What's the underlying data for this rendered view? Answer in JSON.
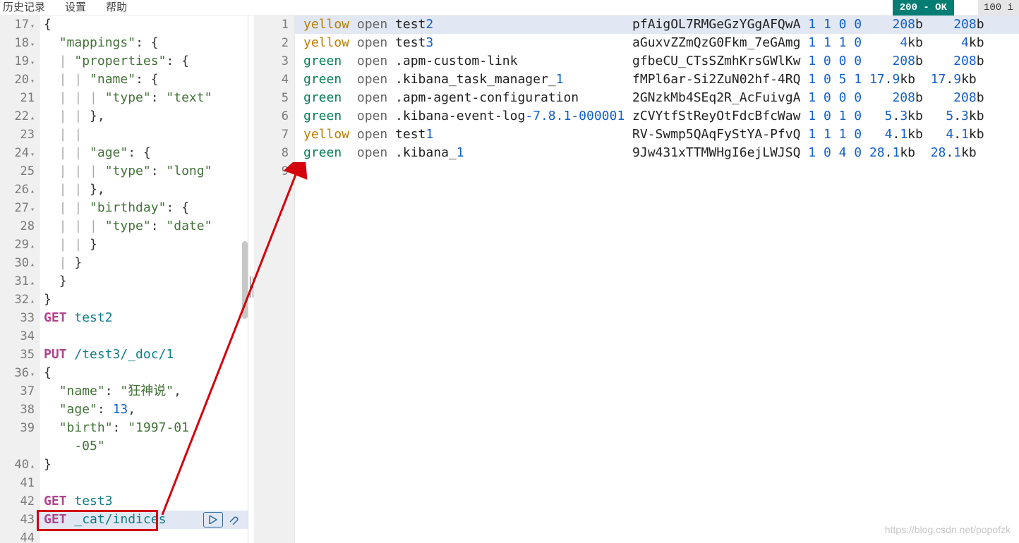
{
  "menubar": {
    "items": [
      "历史记录",
      "设置",
      "帮助"
    ]
  },
  "status": {
    "label": "200 - OK",
    "timing": "100 i"
  },
  "editor": {
    "lines": [
      {
        "n": 17,
        "fold": "down",
        "tokens": [
          {
            "t": "{",
            "c": "punct"
          }
        ]
      },
      {
        "n": 18,
        "fold": "down",
        "tokens": [
          {
            "t": "  ",
            "c": "indent-guide"
          },
          {
            "t": "\"mappings\"",
            "c": "key"
          },
          {
            "t": ": {",
            "c": "punct"
          }
        ]
      },
      {
        "n": 19,
        "fold": "down",
        "tokens": [
          {
            "t": "  | ",
            "c": "indent-guide"
          },
          {
            "t": "\"properties\"",
            "c": "key"
          },
          {
            "t": ": {",
            "c": "punct"
          }
        ]
      },
      {
        "n": 20,
        "fold": "down",
        "tokens": [
          {
            "t": "  | | ",
            "c": "indent-guide"
          },
          {
            "t": "\"name\"",
            "c": "key"
          },
          {
            "t": ": {",
            "c": "punct"
          }
        ]
      },
      {
        "n": 21,
        "tokens": [
          {
            "t": "  | | | ",
            "c": "indent-guide"
          },
          {
            "t": "\"type\"",
            "c": "key"
          },
          {
            "t": ": ",
            "c": "punct"
          },
          {
            "t": "\"text\"",
            "c": "str"
          }
        ]
      },
      {
        "n": 22,
        "fold": "up",
        "tokens": [
          {
            "t": "  | | ",
            "c": "indent-guide"
          },
          {
            "t": "},",
            "c": "punct"
          }
        ]
      },
      {
        "n": 23,
        "tokens": [
          {
            "t": "  | | ",
            "c": "indent-guide"
          }
        ]
      },
      {
        "n": 24,
        "fold": "down",
        "tokens": [
          {
            "t": "  | | ",
            "c": "indent-guide"
          },
          {
            "t": "\"age\"",
            "c": "key"
          },
          {
            "t": ": {",
            "c": "punct"
          }
        ]
      },
      {
        "n": 25,
        "tokens": [
          {
            "t": "  | | | ",
            "c": "indent-guide"
          },
          {
            "t": "\"type\"",
            "c": "key"
          },
          {
            "t": ": ",
            "c": "punct"
          },
          {
            "t": "\"long\"",
            "c": "str"
          }
        ]
      },
      {
        "n": 26,
        "fold": "up",
        "tokens": [
          {
            "t": "  | | ",
            "c": "indent-guide"
          },
          {
            "t": "},",
            "c": "punct"
          }
        ]
      },
      {
        "n": 27,
        "fold": "down",
        "tokens": [
          {
            "t": "  | | ",
            "c": "indent-guide"
          },
          {
            "t": "\"birthday\"",
            "c": "key"
          },
          {
            "t": ": {",
            "c": "punct"
          }
        ]
      },
      {
        "n": 28,
        "tokens": [
          {
            "t": "  | | | ",
            "c": "indent-guide"
          },
          {
            "t": "\"type\"",
            "c": "key"
          },
          {
            "t": ": ",
            "c": "punct"
          },
          {
            "t": "\"date\"",
            "c": "str"
          }
        ]
      },
      {
        "n": 29,
        "fold": "up",
        "tokens": [
          {
            "t": "  | | ",
            "c": "indent-guide"
          },
          {
            "t": "}",
            "c": "punct"
          }
        ]
      },
      {
        "n": 30,
        "fold": "up",
        "tokens": [
          {
            "t": "  | ",
            "c": "indent-guide"
          },
          {
            "t": "}",
            "c": "punct"
          }
        ]
      },
      {
        "n": 31,
        "fold": "up",
        "tokens": [
          {
            "t": "  ",
            "c": "indent-guide"
          },
          {
            "t": "}",
            "c": "punct"
          }
        ]
      },
      {
        "n": 32,
        "fold": "up",
        "tokens": [
          {
            "t": "}",
            "c": "punct"
          }
        ]
      },
      {
        "n": 33,
        "tokens": [
          {
            "t": "GET ",
            "c": "verb"
          },
          {
            "t": "test2",
            "c": "path"
          }
        ]
      },
      {
        "n": 34,
        "tokens": []
      },
      {
        "n": 35,
        "tokens": [
          {
            "t": "PUT ",
            "c": "verb"
          },
          {
            "t": "/test3/_doc/1",
            "c": "path"
          }
        ]
      },
      {
        "n": 36,
        "fold": "down",
        "tokens": [
          {
            "t": "{",
            "c": "punct"
          }
        ]
      },
      {
        "n": 37,
        "tokens": [
          {
            "t": "  ",
            "c": "indent-guide"
          },
          {
            "t": "\"name\"",
            "c": "key"
          },
          {
            "t": ": ",
            "c": "punct"
          },
          {
            "t": "\"狂神说\"",
            "c": "str"
          },
          {
            "t": ",",
            "c": "punct"
          }
        ]
      },
      {
        "n": 38,
        "tokens": [
          {
            "t": "  ",
            "c": "indent-guide"
          },
          {
            "t": "\"age\"",
            "c": "key"
          },
          {
            "t": ": ",
            "c": "punct"
          },
          {
            "t": "13",
            "c": "num"
          },
          {
            "t": ",",
            "c": "punct"
          }
        ]
      },
      {
        "n": 39,
        "tokens": [
          {
            "t": "  ",
            "c": "indent-guide"
          },
          {
            "t": "\"birth\"",
            "c": "key"
          },
          {
            "t": ": ",
            "c": "punct"
          },
          {
            "t": "\"1997-01",
            "c": "str"
          }
        ]
      },
      {
        "n": null,
        "tokens": [
          {
            "t": "    -05\"",
            "c": "str"
          }
        ]
      },
      {
        "n": 40,
        "fold": "up",
        "tokens": [
          {
            "t": "}",
            "c": "punct"
          }
        ]
      },
      {
        "n": 41,
        "tokens": []
      },
      {
        "n": 42,
        "tokens": [
          {
            "t": "GET ",
            "c": "verb"
          },
          {
            "t": "test3",
            "c": "path"
          }
        ]
      },
      {
        "n": 43,
        "tokens": [
          {
            "t": "GET ",
            "c": "verb"
          },
          {
            "t": "_cat/indices",
            "c": "path"
          }
        ],
        "actions": true,
        "hl": true
      },
      {
        "n": 44,
        "tokens": []
      }
    ]
  },
  "output": {
    "rows": [
      {
        "n": 1,
        "hl": true,
        "tokens": [
          {
            "t": "yellow ",
            "c": "yellow"
          },
          {
            "t": "open ",
            "c": "open"
          },
          {
            "t": "test",
            "c": "idx"
          },
          {
            "t": "2",
            "c": "numtok"
          },
          {
            "t": "                          ",
            "c": "plain"
          },
          {
            "t": "pfAigOL7RMGeGzYGgAFQwA ",
            "c": "uuid"
          },
          {
            "t": "1 1 0 0",
            "c": "numtok"
          },
          {
            "t": "    ",
            "c": "plain"
          },
          {
            "t": "208",
            "c": "numtok"
          },
          {
            "t": "b    ",
            "c": "plain"
          },
          {
            "t": "208",
            "c": "numtok"
          },
          {
            "t": "b",
            "c": "plain"
          }
        ]
      },
      {
        "n": 2,
        "tokens": [
          {
            "t": "yellow ",
            "c": "yellow"
          },
          {
            "t": "open ",
            "c": "open"
          },
          {
            "t": "test",
            "c": "idx"
          },
          {
            "t": "3",
            "c": "numtok"
          },
          {
            "t": "                          ",
            "c": "plain"
          },
          {
            "t": "aGuxvZZmQzG0Fkm_7eGAmg ",
            "c": "uuid"
          },
          {
            "t": "1 1 1 0",
            "c": "numtok"
          },
          {
            "t": "     ",
            "c": "plain"
          },
          {
            "t": "4",
            "c": "numtok"
          },
          {
            "t": "kb     ",
            "c": "plain"
          },
          {
            "t": "4",
            "c": "numtok"
          },
          {
            "t": "kb",
            "c": "plain"
          }
        ]
      },
      {
        "n": 3,
        "tokens": [
          {
            "t": "green  ",
            "c": "greenw"
          },
          {
            "t": "open ",
            "c": "open"
          },
          {
            "t": ".apm-custom-link               ",
            "c": "sysidx"
          },
          {
            "t": "gfbeCU_CTsSZmhKrsGWlKw ",
            "c": "uuid"
          },
          {
            "t": "1 0 0 0",
            "c": "numtok"
          },
          {
            "t": "    ",
            "c": "plain"
          },
          {
            "t": "208",
            "c": "numtok"
          },
          {
            "t": "b    ",
            "c": "plain"
          },
          {
            "t": "208",
            "c": "numtok"
          },
          {
            "t": "b",
            "c": "plain"
          }
        ]
      },
      {
        "n": 4,
        "tokens": [
          {
            "t": "green  ",
            "c": "greenw"
          },
          {
            "t": "open ",
            "c": "open"
          },
          {
            "t": ".kibana_task_manager_",
            "c": "sysidx"
          },
          {
            "t": "1",
            "c": "numtok"
          },
          {
            "t": "         ",
            "c": "plain"
          },
          {
            "t": "fMPl6ar-Si2ZuN02hf-4RQ ",
            "c": "uuid"
          },
          {
            "t": "1 0 5 1 17",
            "c": "numtok"
          },
          {
            "t": ".",
            "c": "plain"
          },
          {
            "t": "9",
            "c": "numtok"
          },
          {
            "t": "kb  ",
            "c": "plain"
          },
          {
            "t": "17",
            "c": "numtok"
          },
          {
            "t": ".",
            "c": "plain"
          },
          {
            "t": "9",
            "c": "numtok"
          },
          {
            "t": "kb",
            "c": "plain"
          }
        ]
      },
      {
        "n": 5,
        "tokens": [
          {
            "t": "green  ",
            "c": "greenw"
          },
          {
            "t": "open ",
            "c": "open"
          },
          {
            "t": ".apm-agent-configuration       ",
            "c": "sysidx"
          },
          {
            "t": "2GNzkMb4SEq2R_AcFuivgA ",
            "c": "uuid"
          },
          {
            "t": "1 0 0 0",
            "c": "numtok"
          },
          {
            "t": "    ",
            "c": "plain"
          },
          {
            "t": "208",
            "c": "numtok"
          },
          {
            "t": "b    ",
            "c": "plain"
          },
          {
            "t": "208",
            "c": "numtok"
          },
          {
            "t": "b",
            "c": "plain"
          }
        ]
      },
      {
        "n": 6,
        "tokens": [
          {
            "t": "green  ",
            "c": "greenw"
          },
          {
            "t": "open ",
            "c": "open"
          },
          {
            "t": ".kibana-event-log",
            "c": "sysidx"
          },
          {
            "t": "-7.8.1-000001",
            "c": "versuffix"
          },
          {
            "t": " ",
            "c": "plain"
          },
          {
            "t": "zCVYtfStReyOtFdcBfcWaw ",
            "c": "uuid"
          },
          {
            "t": "1 0 1 0",
            "c": "numtok"
          },
          {
            "t": "   ",
            "c": "plain"
          },
          {
            "t": "5",
            "c": "numtok"
          },
          {
            "t": ".",
            "c": "plain"
          },
          {
            "t": "3",
            "c": "numtok"
          },
          {
            "t": "kb   ",
            "c": "plain"
          },
          {
            "t": "5",
            "c": "numtok"
          },
          {
            "t": ".",
            "c": "plain"
          },
          {
            "t": "3",
            "c": "numtok"
          },
          {
            "t": "kb",
            "c": "plain"
          }
        ]
      },
      {
        "n": 7,
        "tokens": [
          {
            "t": "yellow ",
            "c": "yellow"
          },
          {
            "t": "open ",
            "c": "open"
          },
          {
            "t": "test",
            "c": "idx"
          },
          {
            "t": "1",
            "c": "numtok"
          },
          {
            "t": "                          ",
            "c": "plain"
          },
          {
            "t": "RV-Swmp5QAqFyStYA-PfvQ ",
            "c": "uuid"
          },
          {
            "t": "1 1 1 0",
            "c": "numtok"
          },
          {
            "t": "   ",
            "c": "plain"
          },
          {
            "t": "4",
            "c": "numtok"
          },
          {
            "t": ".",
            "c": "plain"
          },
          {
            "t": "1",
            "c": "numtok"
          },
          {
            "t": "kb   ",
            "c": "plain"
          },
          {
            "t": "4",
            "c": "numtok"
          },
          {
            "t": ".",
            "c": "plain"
          },
          {
            "t": "1",
            "c": "numtok"
          },
          {
            "t": "kb",
            "c": "plain"
          }
        ]
      },
      {
        "n": 8,
        "tokens": [
          {
            "t": "green  ",
            "c": "greenw"
          },
          {
            "t": "open ",
            "c": "open"
          },
          {
            "t": ".kibana_",
            "c": "sysidx"
          },
          {
            "t": "1",
            "c": "numtok"
          },
          {
            "t": "                      ",
            "c": "plain"
          },
          {
            "t": "9Jw431xTTMWHgI6ejLWJSQ ",
            "c": "uuid"
          },
          {
            "t": "1 0 4 0 28",
            "c": "numtok"
          },
          {
            "t": ".",
            "c": "plain"
          },
          {
            "t": "1",
            "c": "numtok"
          },
          {
            "t": "kb  ",
            "c": "plain"
          },
          {
            "t": "28",
            "c": "numtok"
          },
          {
            "t": ".",
            "c": "plain"
          },
          {
            "t": "1",
            "c": "numtok"
          },
          {
            "t": "kb",
            "c": "plain"
          }
        ]
      },
      {
        "n": 9,
        "tokens": []
      }
    ]
  },
  "watermark": "https://blog.csdn.net/popofzk"
}
